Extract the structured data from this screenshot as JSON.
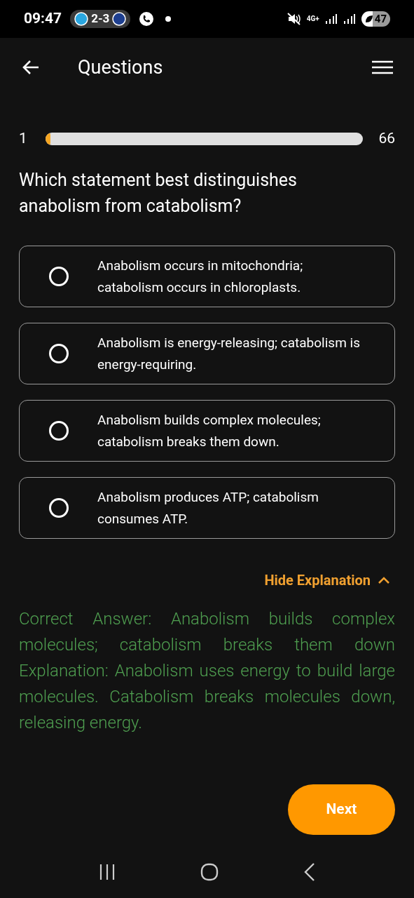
{
  "status_bar": {
    "time": "09:47",
    "score": "2-3",
    "network": "4G+",
    "battery": "47"
  },
  "header": {
    "title": "Questions"
  },
  "progress": {
    "current": "1",
    "total": "66",
    "level": 0.015
  },
  "question": "Which statement best distinguishes anabolism from catabolism?",
  "options": [
    {
      "text": "Anabolism occurs in mitochondria; catabolism occurs in chloroplasts.",
      "selected": false
    },
    {
      "text": "Anabolism is energy-releasing; catabolism is energy-requiring.",
      "selected": false
    },
    {
      "text": "Anabolism builds complex molecules; catabolism breaks them down.",
      "selected": false
    },
    {
      "text": "Anabolism produces ATP; catabolism consumes ATP.",
      "selected": false
    }
  ],
  "explanation_toggle": {
    "label": "Hide Explanation",
    "expanded": true
  },
  "explanation": [
    "Correct Answer: Anabolism builds complex molecules; catabolism breaks them down",
    "Explanation: Anabolism uses energy to build large molecules. Catabolism breaks molecules down, releasing energy."
  ],
  "next_button": "Next"
}
